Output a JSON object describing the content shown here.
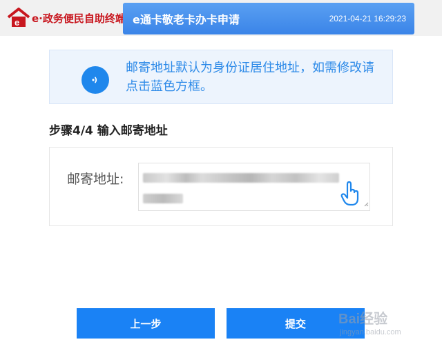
{
  "header": {
    "brand_text": "e·政务便民自助终端",
    "title": "e通卡敬老卡办卡申请",
    "datetime": "2021-04-21 16:29:23"
  },
  "notice": {
    "text": "邮寄地址默认为身份证居住地址，如需修改请点击蓝色方框。",
    "icon": "speaker-icon"
  },
  "step": {
    "title": "步骤4/4 输入邮寄地址"
  },
  "form": {
    "address_label": "邮寄地址:",
    "address_value_blurred": true
  },
  "buttons": {
    "prev_label": "上一步",
    "submit_label": "提交"
  },
  "watermark": {
    "main": "Bai经验",
    "sub": "jingyan.baidu.com"
  },
  "colors": {
    "accent": "#1a82f5",
    "brand_red": "#c8171f",
    "notice_bg": "#edf4fd",
    "notice_text": "#2d8ae8"
  }
}
